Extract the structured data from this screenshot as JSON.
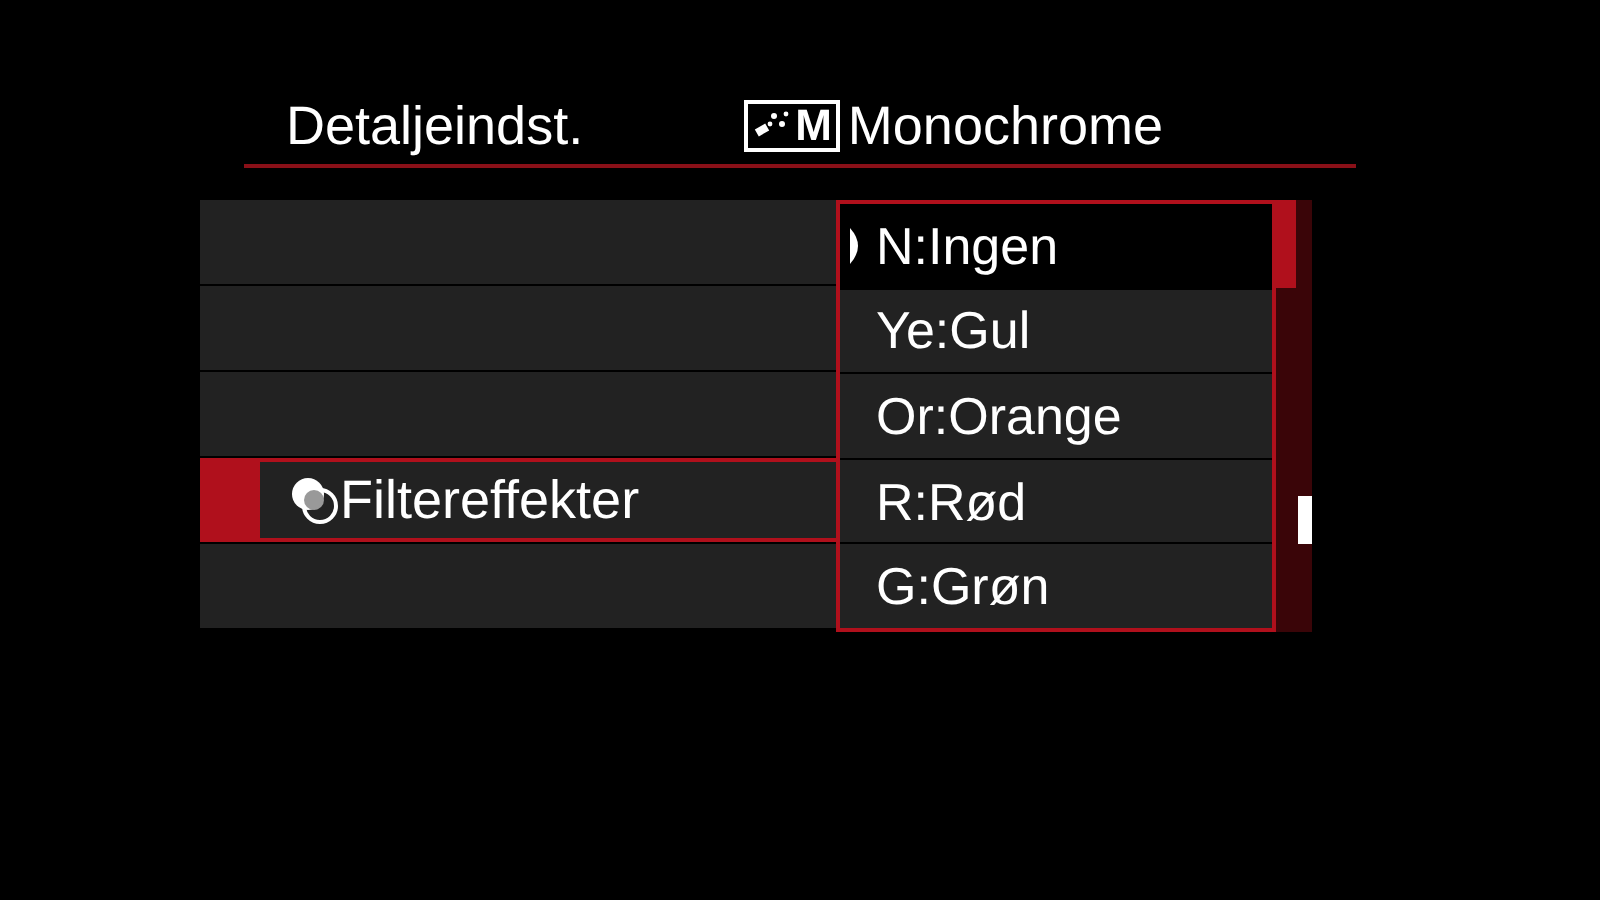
{
  "header": {
    "title": "Detaljeindst.",
    "style_badge": "M",
    "style_name": "Monochrome"
  },
  "menu_rows": [
    {
      "selected": false
    },
    {
      "selected": false
    },
    {
      "selected": false
    },
    {
      "label": "Filtereffekter",
      "selected": true
    },
    {
      "selected": false
    }
  ],
  "options": [
    {
      "label": "N:Ingen",
      "selected": true
    },
    {
      "label": "Ye:Gul",
      "selected": false
    },
    {
      "label": "Or:Orange",
      "selected": false
    },
    {
      "label": "R:Rød",
      "selected": false
    },
    {
      "label": "G:Grøn",
      "selected": false
    }
  ]
}
